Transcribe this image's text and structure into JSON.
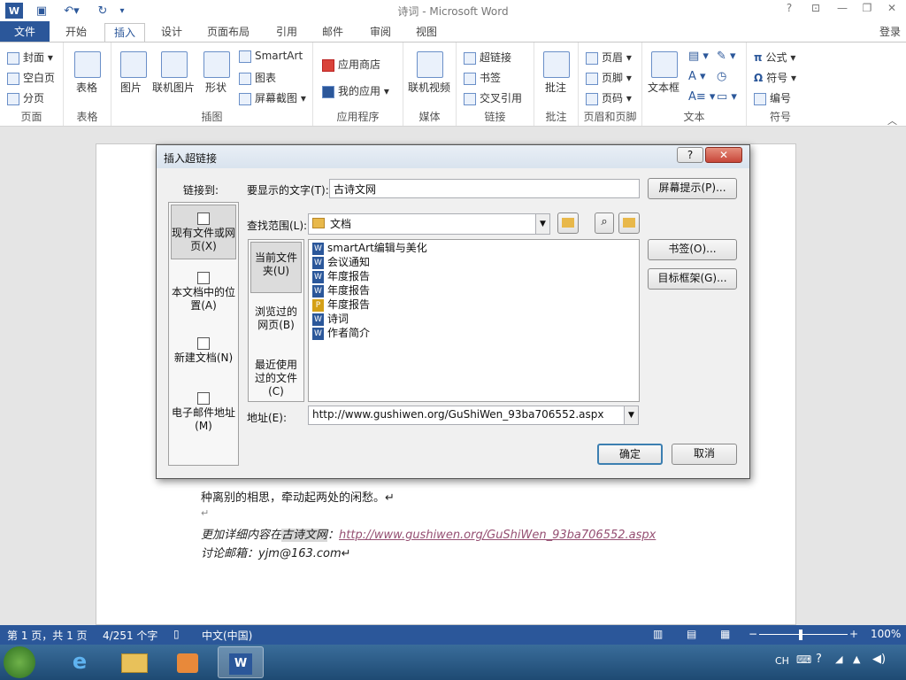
{
  "window": {
    "title": "诗词 - Microsoft Word",
    "login": "登录"
  },
  "tabs": [
    "文件",
    "开始",
    "插入",
    "设计",
    "页面布局",
    "引用",
    "邮件",
    "审阅",
    "视图"
  ],
  "ribbon": {
    "groups": [
      {
        "label": "页面",
        "items": [
          "封面",
          "空白页",
          "分页"
        ]
      },
      {
        "label": "表格",
        "items": [
          "表格"
        ]
      },
      {
        "label": "插图",
        "items": [
          "图片",
          "联机图片",
          "形状",
          "SmartArt",
          "图表",
          "屏幕截图"
        ]
      },
      {
        "label": "应用程序",
        "items": [
          "应用商店",
          "我的应用"
        ]
      },
      {
        "label": "媒体",
        "items": [
          "联机视频"
        ]
      },
      {
        "label": "链接",
        "items": [
          "超链接",
          "书签",
          "交叉引用"
        ]
      },
      {
        "label": "批注",
        "items": [
          "批注"
        ]
      },
      {
        "label": "页眉和页脚",
        "items": [
          "页眉",
          "页脚",
          "页码"
        ]
      },
      {
        "label": "文本",
        "items": [
          "文本框"
        ]
      },
      {
        "label": "符号",
        "items": [
          "公式",
          "符号",
          "编号"
        ]
      }
    ]
  },
  "document": {
    "line1": "种离别的相思，牵动起两处的闲愁。↵",
    "line2": "↵",
    "line3_prefix": "更加详细内容在",
    "line3_hl": "古诗文网",
    "line3_colon": "：",
    "line3_link": "http://www.gushiwen.org/GuShiWen_93ba706552.aspx",
    "line4": "讨论邮箱：yjm@163.com↵"
  },
  "status": {
    "page": "第 1 页，共 1 页",
    "words": "4/251 个字",
    "lang": "中文(中国)",
    "zoom": "100%"
  },
  "taskbar": {
    "ime": "CH"
  },
  "dialog": {
    "title": "插入超链接",
    "help": "?",
    "close": "✕",
    "link_to_label": "链接到:",
    "display_label": "要显示的文字(T):",
    "display_value": "古诗文网",
    "screentip": "屏幕提示(P)...",
    "lookin_label": "查找范围(L):",
    "lookin_value": "文档",
    "nav": [
      "现有文件或网页(X)",
      "本文档中的位置(A)",
      "新建文档(N)",
      "电子邮件地址(M)"
    ],
    "subnav": [
      "当前文件夹(U)",
      "浏览过的网页(B)",
      "最近使用过的文件(C)"
    ],
    "files": [
      "smartArt编辑与美化",
      "会议通知",
      "年度报告",
      "年度报告",
      "年度报告",
      "诗词",
      "作者简介"
    ],
    "bookmark": "书签(O)...",
    "target_frame": "目标框架(G)...",
    "address_label": "地址(E):",
    "address_value": "http://www.gushiwen.org/GuShiWen_93ba706552.aspx",
    "ok": "确定",
    "cancel": "取消"
  }
}
